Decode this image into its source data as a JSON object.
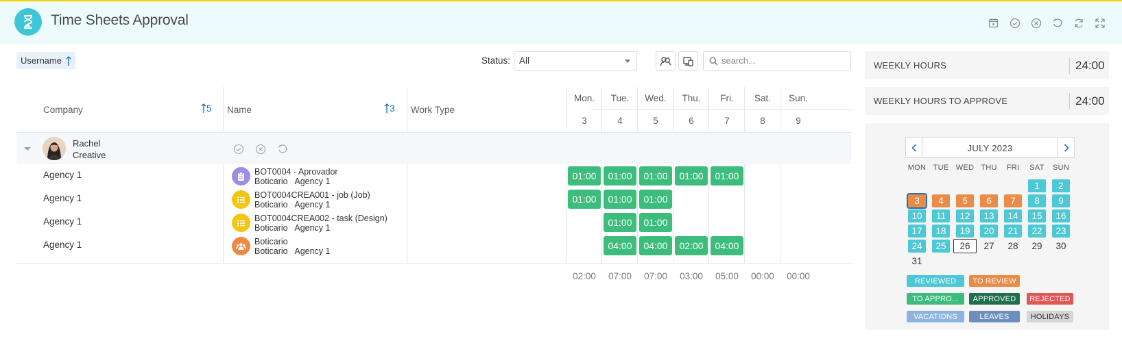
{
  "app": {
    "title": "Time Sheets Approval",
    "header_icons": [
      "calendar-icon",
      "check-circle-icon",
      "x-circle-icon",
      "undo-icon",
      "refresh-icon",
      "expand-icon"
    ]
  },
  "toolbar": {
    "sort_chip": "Username",
    "status_label": "Status:",
    "status_value": "All",
    "search_placeholder": "search..."
  },
  "table": {
    "headers": {
      "company": "Company",
      "name": "Name",
      "work_type": "Work Type"
    },
    "company_sort_order": "5",
    "name_sort_order": "3",
    "days": [
      {
        "name": "Mon.",
        "num": "3"
      },
      {
        "name": "Tue.",
        "num": "4"
      },
      {
        "name": "Wed.",
        "num": "5"
      },
      {
        "name": "Thu.",
        "num": "6"
      },
      {
        "name": "Fri.",
        "num": "7"
      },
      {
        "name": "Sat.",
        "num": "8"
      },
      {
        "name": "Sun.",
        "num": "9"
      }
    ],
    "group": {
      "first": "Rachel",
      "second": "Creative"
    },
    "rows": [
      {
        "company": "Agency 1",
        "task": "BOT0004 - Aprovador",
        "sub": "Boticario   Agency 1",
        "icon": "clipboard-icon",
        "color": "#9b8ee6",
        "hours": [
          "01:00",
          "01:00",
          "01:00",
          "01:00",
          "01:00",
          "",
          ""
        ]
      },
      {
        "company": "Agency 1",
        "task": "BOT0004CREA001 - job (Job)",
        "sub": "Boticario   Agency 1",
        "icon": "list-icon",
        "color": "#f2c50f",
        "hours": [
          "01:00",
          "01:00",
          "01:00",
          "",
          "",
          "",
          ""
        ]
      },
      {
        "company": "Agency 1",
        "task": "BOT0004CREA002 - task (Design)",
        "sub": "Boticario   Agency 1",
        "icon": "list-icon",
        "color": "#f2c50f",
        "hours": [
          "",
          "01:00",
          "01:00",
          "",
          "",
          "",
          ""
        ]
      },
      {
        "company": "Agency 1",
        "task": "Boticario",
        "sub": "Boticario   Agency 1",
        "icon": "people-icon",
        "color": "#ee8a45",
        "hours": [
          "",
          "04:00",
          "04:00",
          "02:00",
          "04:00",
          "",
          ""
        ]
      }
    ],
    "totals": [
      "02:00",
      "07:00",
      "07:00",
      "03:00",
      "05:00",
      "00:00",
      "00:00"
    ]
  },
  "summary": {
    "weekly_hours_label": "WEEKLY HOURS",
    "weekly_hours_value": "24:00",
    "weekly_approve_label": "WEEKLY HOURS TO APPROVE",
    "weekly_approve_value": "24:00"
  },
  "calendar": {
    "month": "JULY 2023",
    "weekdays": [
      "MON",
      "TUE",
      "WED",
      "THU",
      "FRI",
      "SAT",
      "SUN"
    ],
    "weeks": [
      [
        null,
        null,
        null,
        null,
        null,
        {
          "d": "1",
          "s": "teal"
        },
        {
          "d": "2",
          "s": "teal"
        }
      ],
      [
        {
          "d": "3",
          "s": "orange-selected"
        },
        {
          "d": "4",
          "s": "orange"
        },
        {
          "d": "5",
          "s": "orange"
        },
        {
          "d": "6",
          "s": "orange"
        },
        {
          "d": "7",
          "s": "orange"
        },
        {
          "d": "8",
          "s": "teal"
        },
        {
          "d": "9",
          "s": "teal"
        }
      ],
      [
        {
          "d": "10",
          "s": "teal"
        },
        {
          "d": "11",
          "s": "teal"
        },
        {
          "d": "12",
          "s": "teal"
        },
        {
          "d": "13",
          "s": "teal"
        },
        {
          "d": "14",
          "s": "teal"
        },
        {
          "d": "15",
          "s": "teal"
        },
        {
          "d": "16",
          "s": "teal"
        }
      ],
      [
        {
          "d": "17",
          "s": "teal"
        },
        {
          "d": "18",
          "s": "teal"
        },
        {
          "d": "19",
          "s": "teal"
        },
        {
          "d": "20",
          "s": "teal"
        },
        {
          "d": "21",
          "s": "teal"
        },
        {
          "d": "22",
          "s": "teal"
        },
        {
          "d": "23",
          "s": "teal"
        }
      ],
      [
        {
          "d": "24",
          "s": "teal"
        },
        {
          "d": "25",
          "s": "teal"
        },
        {
          "d": "26",
          "s": "today"
        },
        {
          "d": "27",
          "s": "plain"
        },
        {
          "d": "28",
          "s": "plain"
        },
        {
          "d": "29",
          "s": "plain"
        },
        {
          "d": "30",
          "s": "plain"
        }
      ],
      [
        {
          "d": "31",
          "s": "plain"
        },
        null,
        null,
        null,
        null,
        null,
        null
      ]
    ],
    "legend": [
      [
        {
          "label": "REVIEWED",
          "color": "#4dc8d5",
          "text": "#ffffff"
        },
        {
          "label": "TO REVIEW",
          "color": "#e98c47",
          "text": "#ffffff"
        }
      ],
      [
        {
          "label": "TO APPRO...",
          "color": "#3dbd7d",
          "text": "#ffffff"
        },
        {
          "label": "APPROVED",
          "color": "#1f6e4c",
          "text": "#ffffff"
        },
        {
          "label": "REJECTED",
          "color": "#e05656",
          "text": "#ffffff"
        }
      ],
      [
        {
          "label": "VACATIONS",
          "color": "#8fb3e0",
          "text": "#ffffff"
        },
        {
          "label": "LEAVES",
          "color": "#6d8fbf",
          "text": "#ffffff"
        },
        {
          "label": "HOLIDAYS",
          "color": "#d6d6d6",
          "text": "#333333"
        }
      ]
    ]
  },
  "colors": {
    "accent": "#3ec6d6",
    "sort_blue": "#1e73b8",
    "hours_green": "#3dbd7d",
    "top_border": "#f5d300"
  }
}
